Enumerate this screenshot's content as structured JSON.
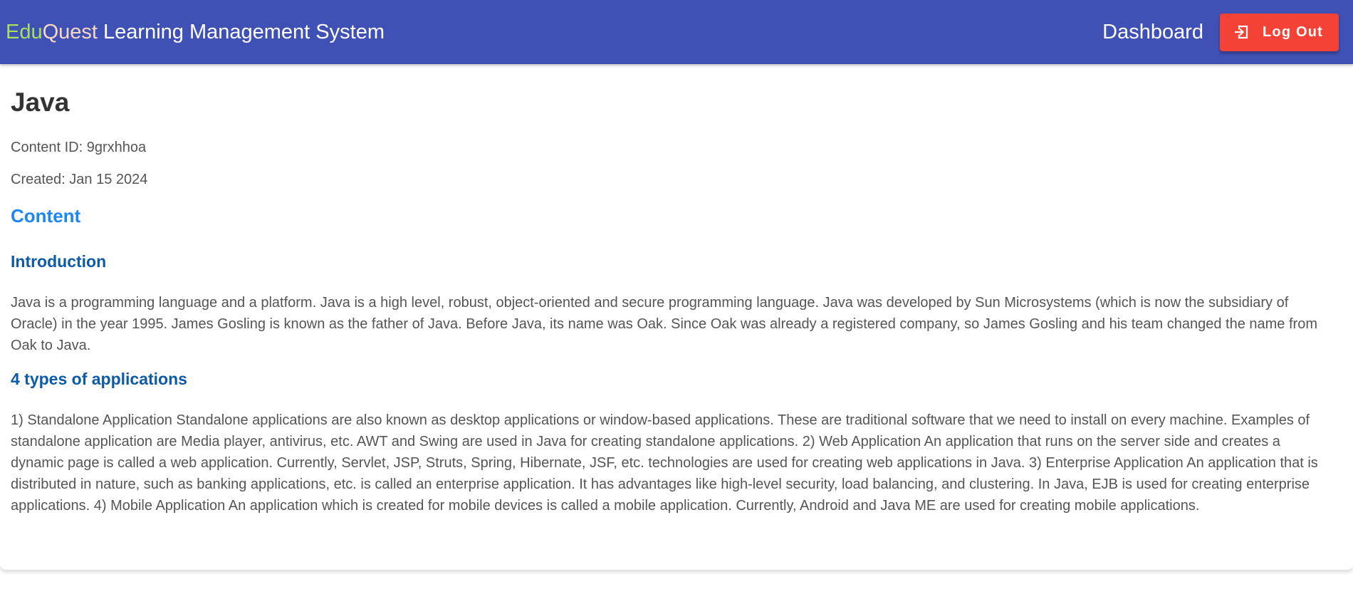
{
  "header": {
    "brand_edu": "Edu",
    "brand_quest": "Quest",
    "brand_rest": " Learning Management System",
    "nav_dashboard": "Dashboard",
    "logout_label": "Log Out",
    "colors": {
      "appbar": "#3f51b5",
      "brand_edu": "#a5e05e",
      "brand_quest": "#f6d7c0",
      "logout_button": "#f44336"
    }
  },
  "content": {
    "title": "Java",
    "content_id": "Content ID: 9grxhhoa",
    "created": "Created: Jan 15 2024",
    "section_heading": "Content",
    "sections": [
      {
        "heading": "Introduction",
        "body": "Java is a programming language and a platform. Java is a high level, robust, object-oriented and secure programming language. Java was developed by Sun Microsystems (which is now the subsidiary of Oracle) in the year 1995. James Gosling is known as the father of Java. Before Java, its name was Oak. Since Oak was already a registered company, so James Gosling and his team changed the name from Oak to Java."
      },
      {
        "heading": "4 types of applications",
        "body": "1) Standalone Application Standalone applications are also known as desktop applications or window-based applications. These are traditional software that we need to install on every machine. Examples of standalone application are Media player, antivirus, etc. AWT and Swing are used in Java for creating standalone applications. 2) Web Application An application that runs on the server side and creates a dynamic page is called a web application. Currently, Servlet, JSP, Struts, Spring, Hibernate, JSF, etc. technologies are used for creating web applications in Java. 3) Enterprise Application An application that is distributed in nature, such as banking applications, etc. is called an enterprise application. It has advantages like high-level security, load balancing, and clustering. In Java, EJB is used for creating enterprise applications. 4) Mobile Application An application which is created for mobile devices is called a mobile application. Currently, Android and Java ME are used for creating mobile applications."
      }
    ],
    "colors": {
      "section_heading": "#1a88f0",
      "sub_heading": "#0d5aa7"
    }
  },
  "icons": {
    "logout": "logout-icon"
  }
}
